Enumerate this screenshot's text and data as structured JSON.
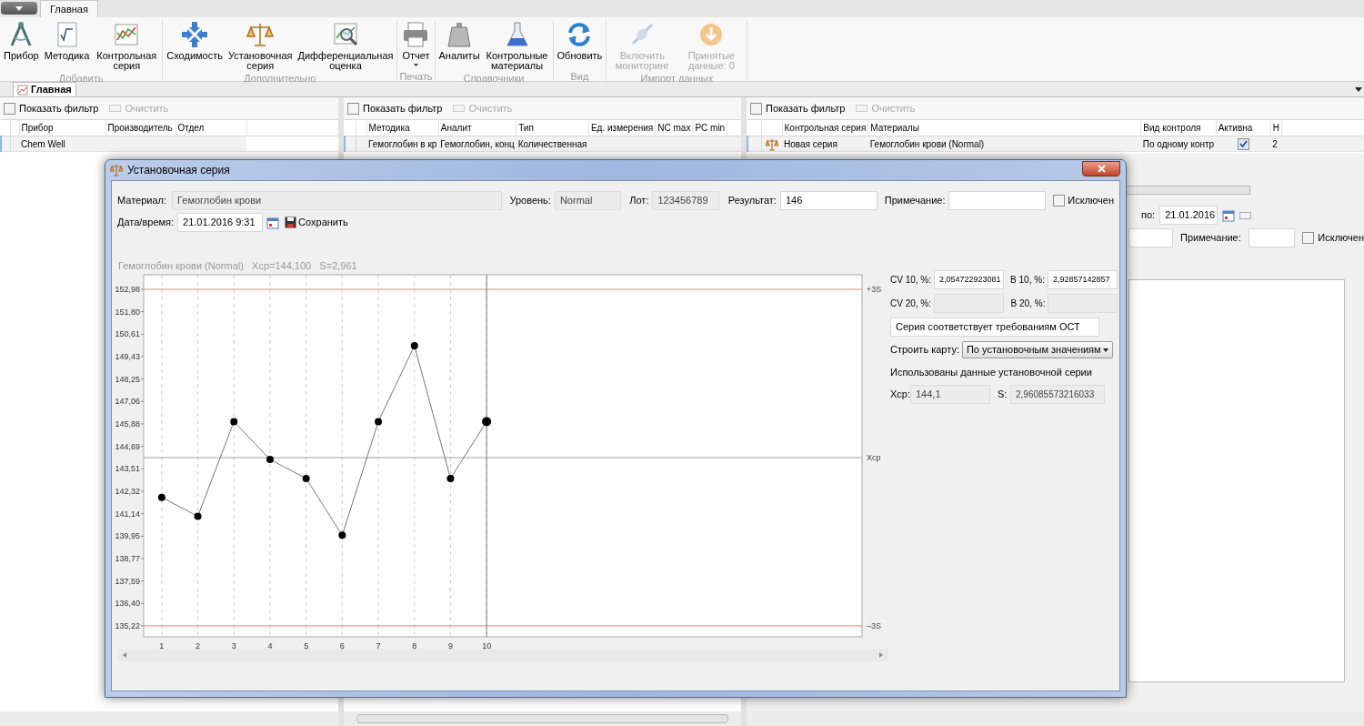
{
  "ribbon": {
    "tabs": [
      {
        "label": "Главная",
        "selected": true
      }
    ],
    "groups": [
      {
        "title": "Добавить",
        "buttons": [
          {
            "label": "Прибор",
            "disabled": false,
            "menu": false
          },
          {
            "label": "Методика",
            "disabled": false,
            "menu": false
          },
          {
            "label": "Контрольная серия",
            "disabled": false,
            "menu": false
          }
        ]
      },
      {
        "title": "Дополнительно",
        "buttons": [
          {
            "label": "Сходимость",
            "disabled": false,
            "menu": false
          },
          {
            "label": "Установочная серия",
            "disabled": false,
            "menu": false
          },
          {
            "label": "Дифференциальная оценка",
            "disabled": false,
            "menu": false
          }
        ]
      },
      {
        "title": "Печать",
        "buttons": [
          {
            "label": "Отчет",
            "disabled": false,
            "menu": true
          }
        ]
      },
      {
        "title": "Справочники",
        "buttons": [
          {
            "label": "Аналиты",
            "disabled": false,
            "menu": false
          },
          {
            "label": "Контрольные материалы",
            "disabled": false,
            "menu": false
          }
        ]
      },
      {
        "title": "Вид",
        "buttons": [
          {
            "label": "Обновить",
            "disabled": false,
            "menu": false
          }
        ]
      },
      {
        "title": "Импорт данных",
        "buttons": [
          {
            "label": "Включить мониторинг",
            "disabled": true,
            "menu": false
          },
          {
            "label": "Принятые данные: 0",
            "disabled": true,
            "menu": false
          }
        ]
      }
    ]
  },
  "document_tabs": [
    {
      "label": "Главная",
      "selected": true
    }
  ],
  "panels": [
    {
      "filter": {
        "label": "Показать фильтр",
        "checked": false
      },
      "clear": {
        "label": "Очистить",
        "disabled": true
      },
      "columns": [
        "Прибор",
        "Производитель",
        "Отдел"
      ],
      "rows": [
        {
          "cells": [
            {
              "text": "Chem Well"
            }
          ]
        }
      ]
    },
    {
      "filter": {
        "label": "Показать фильтр",
        "checked": false
      },
      "clear": {
        "label": "Очистить",
        "disabled": true
      },
      "columns": [
        "Методика",
        "Аналит",
        "Тип",
        "Ед. измерения",
        "NC max",
        "PC min"
      ],
      "rows": [
        {
          "cells": [
            {
              "text": "Гемоглобин в кр"
            },
            {
              "text": "Гемоглобин, конц"
            },
            {
              "text": "Количественная"
            }
          ]
        }
      ]
    },
    {
      "filter": {
        "label": "Показать фильтр",
        "checked": false
      },
      "clear": {
        "label": "Очистить",
        "disabled": true
      },
      "columns": [
        "Контрольная серия",
        "Материалы",
        "Вид контроля",
        "Активна",
        "Н"
      ],
      "rows": [
        {
          "cells": [
            {
              "text": "Новая серия"
            },
            {
              "text": "Гемоглобин крови (Normal)"
            },
            {
              "text": "По одному контр"
            },
            {
              "checked": true
            },
            {
              "text": "2"
            }
          ]
        }
      ]
    }
  ],
  "series_form": {
    "to_label": "по:",
    "to_value": "21.01.2016",
    "note_label": "Примечание:",
    "excluded": {
      "label": "Исключен",
      "checked": false
    }
  },
  "dialog": {
    "title": "Установочная серия",
    "material": {
      "label": "Материал:",
      "value": "Гемоглобин крови"
    },
    "level": {
      "label": "Уровень:",
      "value": "Normal"
    },
    "lot": {
      "label": "Лот:",
      "value": "123456789"
    },
    "result": {
      "label": "Результат:",
      "value": "146"
    },
    "note": {
      "label": "Примечание:"
    },
    "excluded": {
      "label": "Исключен",
      "checked": false
    },
    "datetime": {
      "label": "Дата/время:",
      "value": "21.01.2016 9:31"
    },
    "save": {
      "label": "Сохранить"
    },
    "chart_data": {
      "type": "line",
      "title": "Гемоглобин крови (Normal)   Хср=144,100   S=2,961",
      "x": [
        1,
        2,
        3,
        4,
        5,
        6,
        7,
        8,
        9,
        10
      ],
      "series": [
        {
          "color": "#000000",
          "marker": "circle",
          "values": [
            142,
            141,
            146,
            144,
            143,
            140,
            146,
            150,
            143,
            146
          ]
        }
      ],
      "grid": true,
      "xlim": [
        0.5,
        20.4
      ],
      "ylim": [
        134.64,
        153.75
      ],
      "xticks": [
        1,
        2,
        3,
        4,
        5,
        6,
        7,
        8,
        9,
        10
      ],
      "yticks": [
        {
          "value": 135.22,
          "label": "135,22"
        },
        {
          "value": 136.4,
          "label": "136,40"
        },
        {
          "value": 137.59,
          "label": "137,59"
        },
        {
          "value": 138.77,
          "label": "138,77"
        },
        {
          "value": 139.95,
          "label": "139,95"
        },
        {
          "value": 141.14,
          "label": "141,14"
        },
        {
          "value": 142.32,
          "label": "142,32"
        },
        {
          "value": 143.51,
          "label": "143,51"
        },
        {
          "value": 144.69,
          "label": "144,69"
        },
        {
          "value": 145.88,
          "label": "145,88"
        },
        {
          "value": 147.06,
          "label": "147,06"
        },
        {
          "value": 148.25,
          "label": "148,25"
        },
        {
          "value": 149.43,
          "label": "149,43"
        },
        {
          "value": 150.61,
          "label": "150,61"
        },
        {
          "value": 151.8,
          "label": "151,80"
        },
        {
          "value": 152.98,
          "label": "152,98"
        }
      ],
      "ref_lines": [
        {
          "axis": "y",
          "value": 152.98,
          "label": "+3S",
          "color": "#f08080"
        },
        {
          "axis": "y",
          "value": 144.1,
          "label": "Хср",
          "color": "#a0a0a0"
        },
        {
          "axis": "y",
          "value": 135.22,
          "label": "–3S",
          "color": "#f08080"
        },
        {
          "axis": "x",
          "value": 10,
          "color": "#808080"
        }
      ]
    },
    "cv10": {
      "label": "CV 10, %:",
      "value": "2,054722923081"
    },
    "b10": {
      "label": "B 10, %:",
      "value": "2,92857142857"
    },
    "cv20": {
      "label": "CV 20, %:"
    },
    "b20": {
      "label": "B 20, %:"
    },
    "verdict": "Серия соответствует требованиям ОСТ",
    "build": {
      "label": "Строить карту:",
      "value": "По установочным значениям"
    },
    "used_caption": "Использованы данные установочной серии",
    "mean": {
      "label": "Хср:",
      "value": "144,1"
    },
    "sd": {
      "label": "S:",
      "value": "2,96085573216033"
    }
  }
}
